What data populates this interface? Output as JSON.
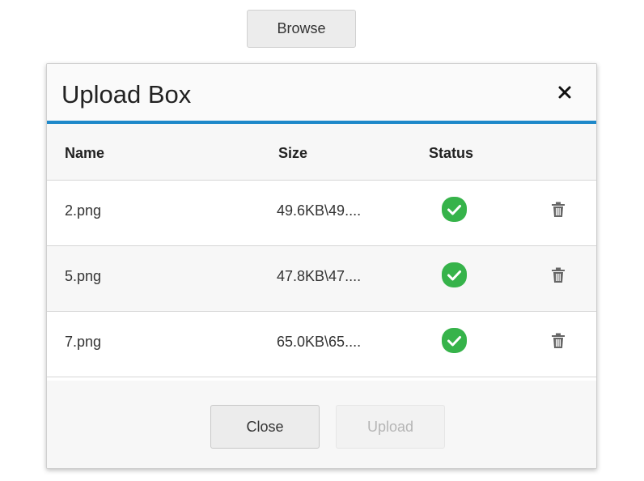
{
  "browse_button": {
    "label": "Browse"
  },
  "dialog": {
    "title": "Upload Box",
    "close_icon": "close-icon",
    "accent_color": "#1e88c9"
  },
  "table": {
    "headers": {
      "name": "Name",
      "size": "Size",
      "status": "Status"
    },
    "rows": [
      {
        "name": "2.png",
        "size": "49.6KB\\49....",
        "status": "success"
      },
      {
        "name": "5.png",
        "size": "47.8KB\\47....",
        "status": "success"
      },
      {
        "name": "7.png",
        "size": "65.0KB\\65....",
        "status": "success"
      }
    ],
    "status_color": "#36b34a"
  },
  "footer": {
    "close_label": "Close",
    "upload_label": "Upload"
  }
}
